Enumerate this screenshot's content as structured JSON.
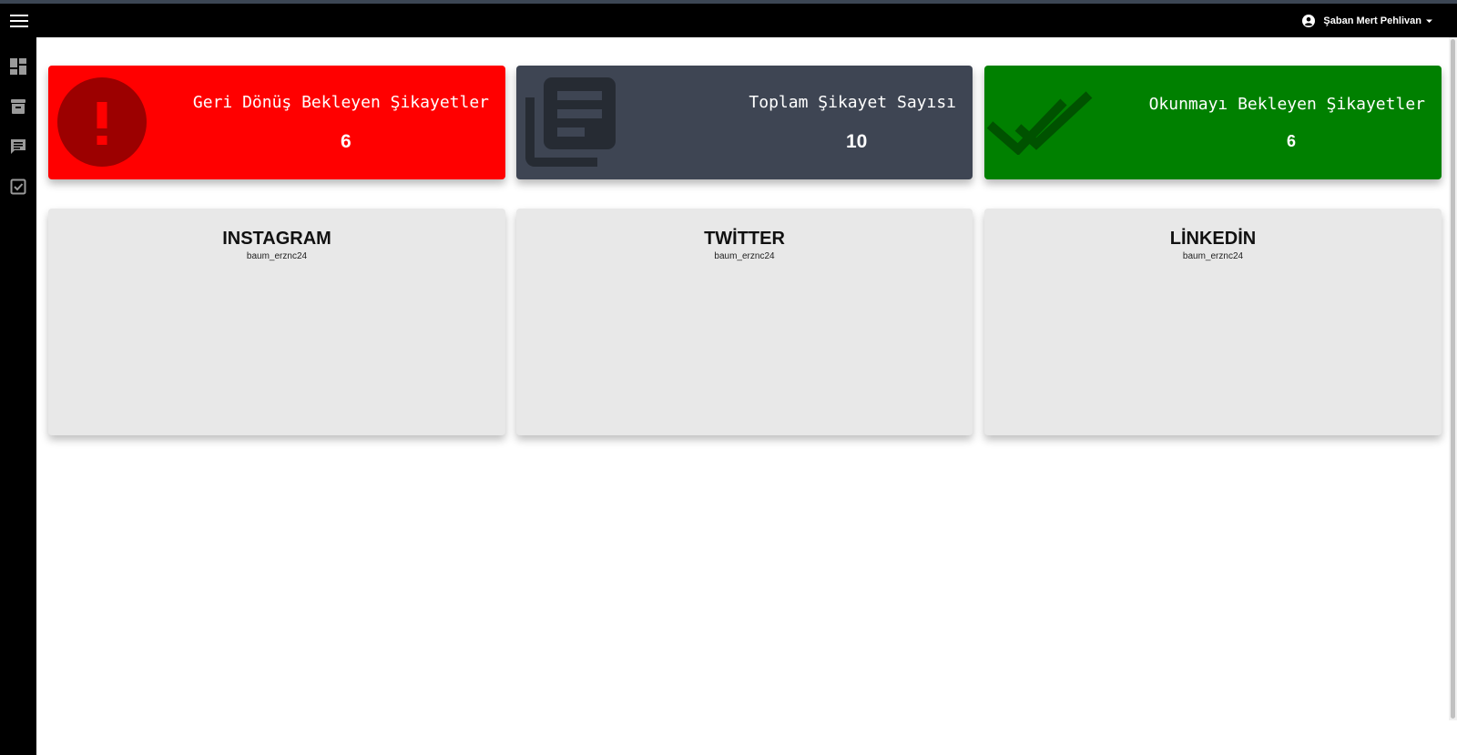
{
  "header": {
    "user_name": "Şaban Mert Pehlivan",
    "icons": [
      "menu-icon",
      "account-circle-icon",
      "caret-down-icon"
    ]
  },
  "sidebar": {
    "items": [
      {
        "icon": "dashboard-icon"
      },
      {
        "icon": "archive-icon"
      },
      {
        "icon": "comment-icon"
      },
      {
        "icon": "check-box-icon"
      }
    ]
  },
  "stats": [
    {
      "title": "Geri Dönüş Bekleyen Şikayetler",
      "value": "6",
      "color": "#ff0000",
      "icon": "alert-circle-icon"
    },
    {
      "title": "Toplam Şikayet Sayısı",
      "value": "10",
      "color": "#3e4553",
      "icon": "library-books-icon"
    },
    {
      "title": "Okunmayı Bekleyen Şikayetler",
      "value": "6",
      "color": "#008000",
      "icon": "double-check-icon"
    }
  ],
  "social": [
    {
      "platform": "INSTAGRAM",
      "handle": "baum_erznc24"
    },
    {
      "platform": "TWİTTER",
      "handle": "baum_erznc24"
    },
    {
      "platform": "LİNKEDİN",
      "handle": "baum_erznc24"
    }
  ]
}
